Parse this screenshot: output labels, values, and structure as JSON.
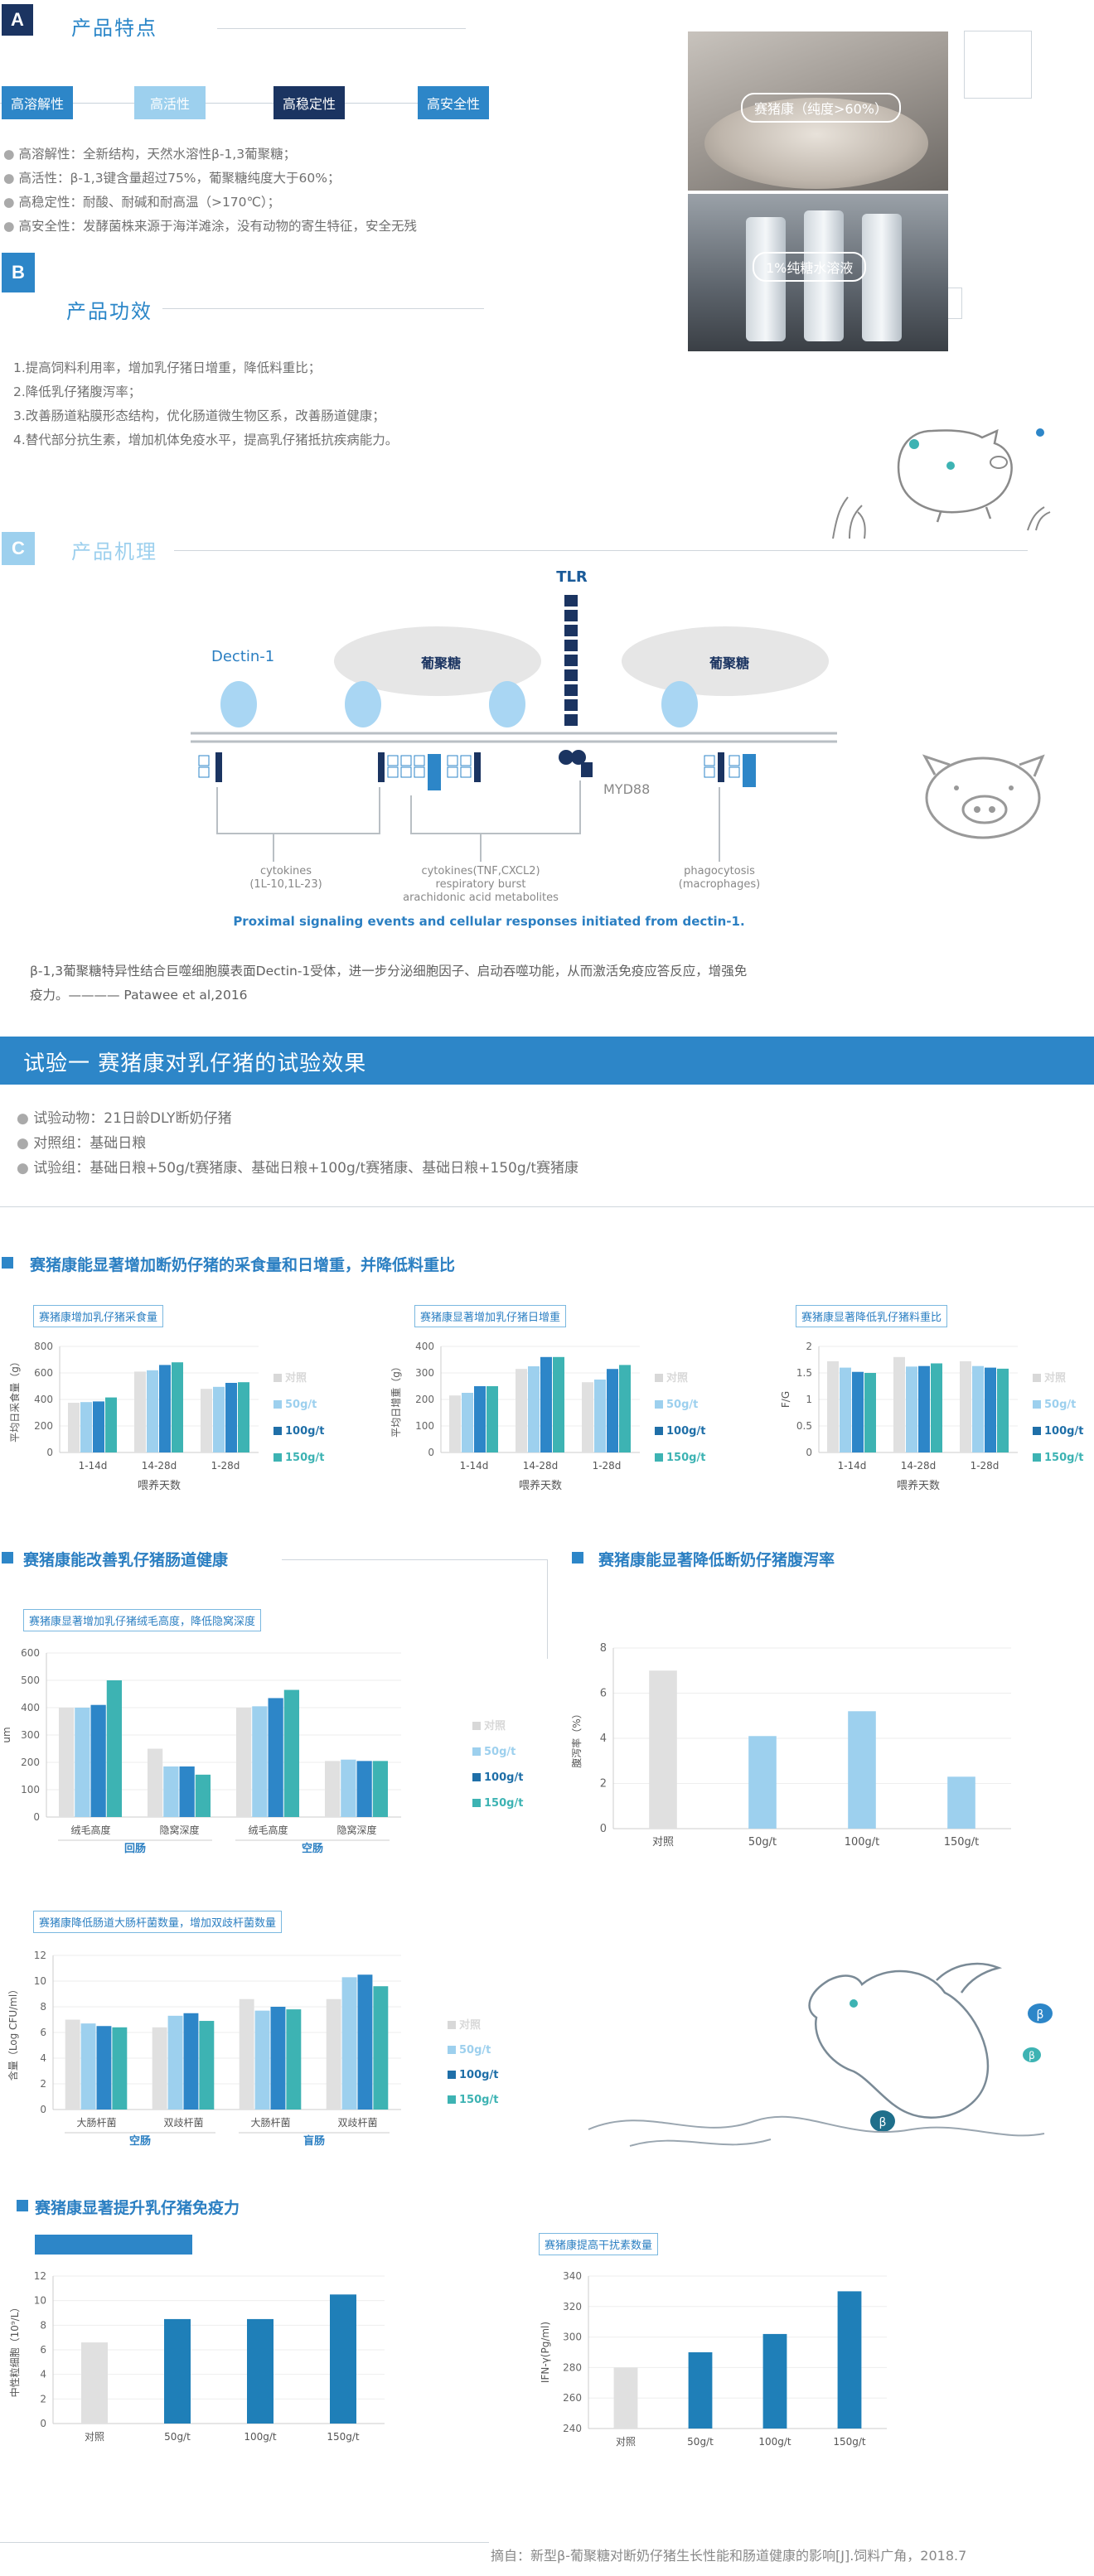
{
  "colors": {
    "blue": "#2d86c8",
    "light_blue": "#9dd0ee",
    "navy": "#1b3461",
    "teal": "#3db3b3",
    "gray": "#e0e0e0",
    "label": "#2b7fc2"
  },
  "section_a": {
    "letter": "A",
    "title": "产品特点",
    "features": [
      "高溶解性",
      "高活性",
      "高稳定性",
      "高安全性"
    ],
    "lines": [
      "高溶解性：全新结构，天然水溶性β-1,3葡聚糖；",
      "高活性：β-1,3键含量超过75%，葡聚糖纯度大于60%；",
      "高稳定性：耐酸、耐碱和耐高温（>170℃）；",
      "高安全性：发酵菌株来源于海洋滩涂，没有动物的寄生特征，安全无残"
    ]
  },
  "photos": {
    "top_label": "赛猪康（纯度>60%）",
    "bottom_label": "1%纯糖水溶液"
  },
  "section_b": {
    "letter": "B",
    "title": "产品功效",
    "lines": [
      "1.提高饲料利用率，增加乳仔猪日增重，降低料重比；",
      "2.降低乳仔猪腹泻率；",
      "3.改善肠道粘膜形态结构，优化肠道微生物区系，改善肠道健康；",
      "4.替代部分抗生素，增加机体免疫水平，提高乳仔猪抵抗疾病能力。"
    ]
  },
  "section_c": {
    "letter": "C",
    "title": "产品机理",
    "diagram": {
      "tlr": "TLR",
      "dectin": "Dectin-1",
      "glucan1": "葡聚糖",
      "glucan2": "葡聚糖",
      "myd88": "MYD88",
      "out1": "cytokines\n(1L-10,1L-23)",
      "out2": "cytokines(TNF,CXCL2)\nrespiratory burst\narachidonic acid metabolites",
      "out3": "phagocytosis\n(macrophages)",
      "caption": "Proximal signaling events and cellular responses initiated from dectin-1."
    },
    "note_line1": "β-1,3葡聚糖特异性结合巨噬细胞膜表面Dectin-1受体，进一步分泌细胞因子、启动吞噬功能，从而激活免疫应答反应，增强免",
    "note_line2": "疫力。————  Patawee et al,2016"
  },
  "trial": {
    "banner": "试验一  赛猪康对乳仔猪的试验效果",
    "lines": [
      "试验动物：21日龄DLY断奶仔猪",
      "对照组：基础日粮",
      "试验组：基础日粮+50g/t赛猪康、基础日粮+100g/t赛猪康、基础日粮+150g/t赛猪康"
    ]
  },
  "legend": [
    "对照",
    "50g/t",
    "100g/t",
    "150g/t"
  ],
  "headings": {
    "h1": "赛猪康能显著增加断奶仔猪的采食量和日增重，并降低料重比",
    "h2": "赛猪康能改善乳仔猪肠道健康",
    "h3": "赛猪康能显著降低断奶仔猪腹泻率",
    "h4": "赛猪康显著提升乳仔猪免疫力"
  },
  "chart_data": [
    {
      "type": "bar",
      "title": "赛猪康增加乳仔猪采食量",
      "categories": [
        "1-14d",
        "14-28d",
        "1-28d"
      ],
      "xlabel": "喂养天数",
      "ylabel": "平均日采食量（g）",
      "ylim": [
        0,
        800
      ],
      "yticks": [
        0,
        200,
        400,
        600,
        800
      ],
      "series": [
        {
          "name": "对照",
          "values": [
            375,
            610,
            480
          ]
        },
        {
          "name": "50g/t",
          "values": [
            380,
            620,
            495
          ]
        },
        {
          "name": "100g/t",
          "values": [
            385,
            660,
            525
          ]
        },
        {
          "name": "150g/t",
          "values": [
            415,
            680,
            530
          ]
        }
      ]
    },
    {
      "type": "bar",
      "title": "赛猪康显著增加乳仔猪日增重",
      "categories": [
        "1-14d",
        "14-28d",
        "1-28d"
      ],
      "xlabel": "喂养天数",
      "ylabel": "平均日增重（g）",
      "ylim": [
        0,
        400
      ],
      "yticks": [
        0,
        100,
        200,
        300,
        400
      ],
      "series": [
        {
          "name": "对照",
          "values": [
            215,
            315,
            265
          ]
        },
        {
          "name": "50g/t",
          "values": [
            225,
            325,
            275
          ]
        },
        {
          "name": "100g/t",
          "values": [
            250,
            360,
            315
          ]
        },
        {
          "name": "150g/t",
          "values": [
            250,
            360,
            330
          ]
        }
      ]
    },
    {
      "type": "bar",
      "title": "赛猪康显著降低乳仔猪料重比",
      "categories": [
        "1-14d",
        "14-28d",
        "1-28d"
      ],
      "xlabel": "喂养天数",
      "ylabel": "F/G",
      "ylim": [
        0,
        2
      ],
      "yticks": [
        0,
        0.5,
        1,
        1.5,
        2
      ],
      "series": [
        {
          "name": "对照",
          "values": [
            1.72,
            1.8,
            1.72
          ]
        },
        {
          "name": "50g/t",
          "values": [
            1.6,
            1.62,
            1.63
          ]
        },
        {
          "name": "100g/t",
          "values": [
            1.52,
            1.63,
            1.6
          ]
        },
        {
          "name": "150g/t",
          "values": [
            1.5,
            1.68,
            1.58
          ]
        }
      ]
    },
    {
      "type": "bar",
      "title": "赛猪康显著增加乳仔猪绒毛高度，降低隐窝深度",
      "categories": [
        "绒毛高度",
        "隐窝深度",
        "绒毛高度",
        "隐窝深度"
      ],
      "groups": [
        "回肠",
        "空肠"
      ],
      "ylabel": "um",
      "ylim": [
        0,
        600
      ],
      "yticks": [
        0,
        100,
        200,
        300,
        400,
        500,
        600
      ],
      "series": [
        {
          "name": "对照",
          "values": [
            400,
            250,
            400,
            205
          ]
        },
        {
          "name": "50g/t",
          "values": [
            400,
            185,
            405,
            210
          ]
        },
        {
          "name": "100g/t",
          "values": [
            410,
            185,
            435,
            205
          ]
        },
        {
          "name": "150g/t",
          "values": [
            500,
            155,
            465,
            205
          ]
        }
      ]
    },
    {
      "type": "bar",
      "title": "",
      "categories": [
        "对照",
        "50g/t",
        "100g/t",
        "150g/t"
      ],
      "ylabel": "腹泻率（%）",
      "ylim": [
        0,
        8
      ],
      "yticks": [
        0,
        2,
        4,
        6,
        8
      ],
      "values": [
        7.0,
        4.1,
        5.2,
        2.3
      ]
    },
    {
      "type": "bar",
      "title": "赛猪康降低肠道大肠杆菌数量，增加双歧杆菌数量",
      "categories": [
        "大肠杆菌",
        "双歧杆菌",
        "大肠杆菌",
        "双歧杆菌"
      ],
      "groups": [
        "空肠",
        "盲肠"
      ],
      "ylabel": "含量（Log CFU/ml）",
      "ylim": [
        0,
        12
      ],
      "yticks": [
        0,
        2,
        4,
        6,
        8,
        10,
        12
      ],
      "series": [
        {
          "name": "对照",
          "values": [
            7.0,
            6.4,
            8.6,
            8.6
          ]
        },
        {
          "name": "50g/t",
          "values": [
            6.7,
            7.3,
            7.7,
            10.3
          ]
        },
        {
          "name": "100g/t",
          "values": [
            6.5,
            7.5,
            8.0,
            10.5
          ]
        },
        {
          "name": "150g/t",
          "values": [
            6.4,
            6.9,
            7.8,
            9.6
          ]
        }
      ]
    },
    {
      "type": "bar",
      "title": "",
      "categories": [
        "对照",
        "50g/t",
        "100g/t",
        "150g/t"
      ],
      "ylabel": "中性粒细胞（10⁹/L）",
      "ylim": [
        0,
        12
      ],
      "yticks": [
        0,
        2,
        4,
        6,
        8,
        10,
        12
      ],
      "values": [
        6.6,
        8.5,
        8.5,
        10.5
      ]
    },
    {
      "type": "bar",
      "title": "赛猪康提高干扰素数量",
      "categories": [
        "对照",
        "50g/t",
        "100g/t",
        "150g/t"
      ],
      "ylabel": "IFN-γ(Pg/ml)",
      "ylim": [
        240,
        340
      ],
      "yticks": [
        240,
        260,
        280,
        300,
        320,
        340
      ],
      "values": [
        280,
        290,
        302,
        330
      ]
    }
  ],
  "source": "摘自：新型β-葡聚糖对断奶仔猪生长性能和肠道健康的影响[J].饲料广角，2018.7"
}
